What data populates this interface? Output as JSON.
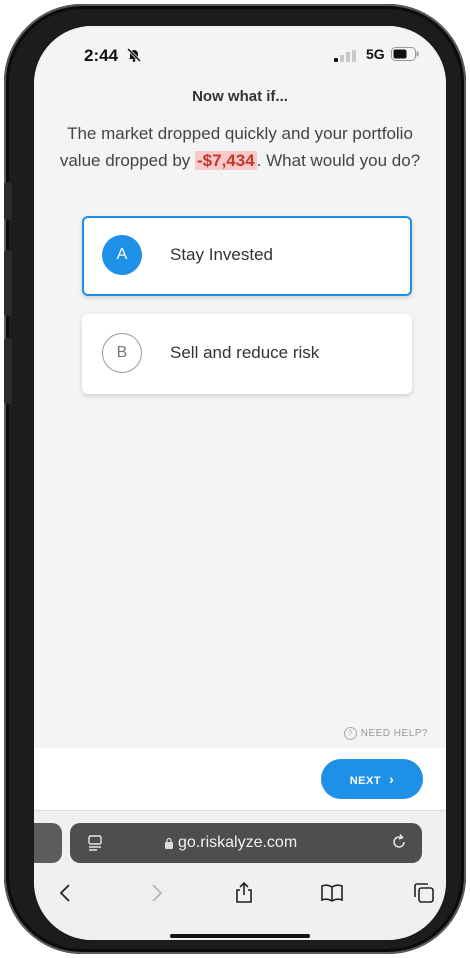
{
  "status_bar": {
    "time": "2:44",
    "network": "5G"
  },
  "question": {
    "heading": "Now what if...",
    "text_before": "The market dropped quickly and your portfolio value dropped by ",
    "amount": "-$7,434",
    "text_after": ". What would you do?"
  },
  "options": [
    {
      "letter": "A",
      "label": "Stay Invested",
      "selected": true
    },
    {
      "letter": "B",
      "label": "Sell and reduce risk",
      "selected": false
    }
  ],
  "help": {
    "label": "NEED HELP?"
  },
  "next_button": {
    "label": "NEXT"
  },
  "browser": {
    "url": "go.riskalyze.com"
  },
  "colors": {
    "accent": "#1e90e8",
    "amount_highlight": "#f7c9c9",
    "amount_text": "#c0392b"
  }
}
